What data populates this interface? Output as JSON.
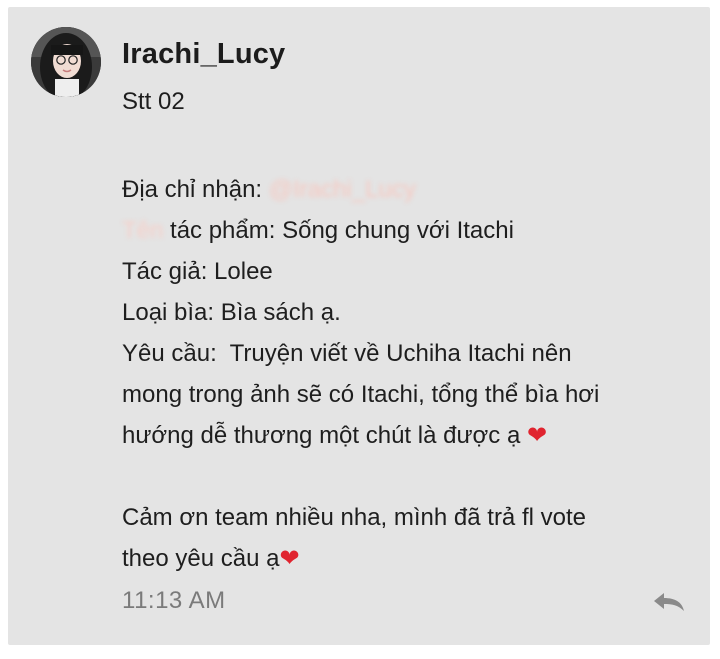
{
  "message": {
    "author": "Irachi_Lucy",
    "subtitle": "Stt 02",
    "lines": [
      {
        "label": "Địa chỉ nhận: ",
        "mention": "@Irachi_Lucy"
      },
      {
        "prefix_redacted": "Tên",
        "text": " tác phẩm: Sống chung với Itachi"
      },
      {
        "text": "Tác giả: Lolee"
      },
      {
        "text": "Loại bìa: Bìa sách ạ."
      },
      {
        "text": "Yêu cầu:  Truyện viết về Uchiha Itachi nên"
      },
      {
        "text": "mong trong ảnh sẽ có Itachi, tổng thể bìa hơi"
      },
      {
        "text": "hướng dễ thương một chút là được ạ ",
        "emoji": "❤"
      },
      {
        "text": "Cảm ơn team nhiều nha, mình đã trả fl vote"
      },
      {
        "text": "theo yêu cầu ạ",
        "emoji": "❤"
      }
    ],
    "timestamp": "11:13 AM"
  },
  "icons": {
    "avatar": "profile-photo",
    "reply": "reply-arrow-icon"
  },
  "colors": {
    "card_background": "#e4e4e4",
    "text": "#1e1e1e",
    "timestamp": "#7a7a7a",
    "heart": "#e0242f",
    "reply_icon": "#8a8a8a"
  }
}
